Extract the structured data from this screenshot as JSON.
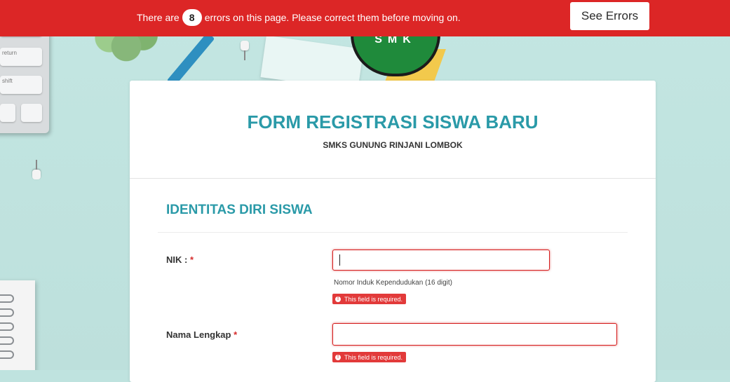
{
  "banner": {
    "message_prefix": "There are",
    "error_count": "8",
    "message_suffix": "errors on this page. Please correct them before moving on.",
    "see_errors_label": "See Errors"
  },
  "background": {
    "keys": [
      "return",
      "shift"
    ],
    "logo_text": "SMK"
  },
  "form": {
    "title": "FORM REGISTRASI SISWA BARU",
    "subtitle": "SMKS GUNUNG RINJANI LOMBOK",
    "section_title": "IDENTITAS DIRI SISWA",
    "fields": [
      {
        "label": "NIK :",
        "required_mark": "*",
        "value": "",
        "sublabel": "Nomor Induk Kependudukan (16 digit)",
        "error": "This field is required."
      },
      {
        "label": "Nama Lengkap",
        "required_mark": "*",
        "value": "",
        "error": "This field is required."
      }
    ]
  },
  "colors": {
    "banner": "#dc2626",
    "accent": "#2a9aa8",
    "error": "#e23a3a"
  }
}
